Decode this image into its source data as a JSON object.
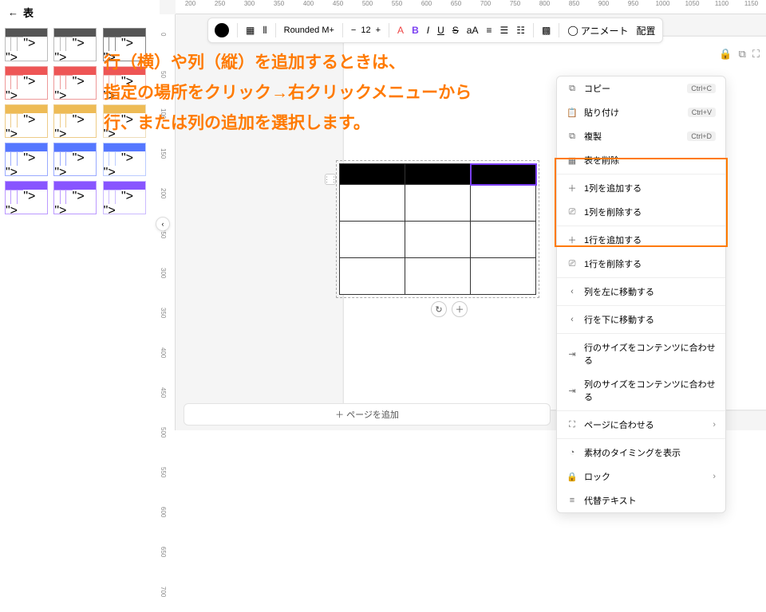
{
  "sidebar": {
    "back": "←",
    "title": "表"
  },
  "ruler_h": [
    "200",
    "250",
    "300",
    "350",
    "400",
    "450",
    "500",
    "550",
    "600",
    "650",
    "700",
    "750",
    "800",
    "850",
    "900",
    "950",
    "1000",
    "1050",
    "1100",
    "1150"
  ],
  "ruler_v": [
    "0",
    "50",
    "100",
    "150",
    "200",
    "250",
    "300",
    "350",
    "400",
    "450",
    "500",
    "550",
    "600",
    "650",
    "700"
  ],
  "toolbar": {
    "font": "Rounded M+",
    "minus": "−",
    "size": "12",
    "plus": "+",
    "bold": "B",
    "italic": "I",
    "underline": "U",
    "strike": "S",
    "aa": "aA",
    "animate": "アニメート",
    "pos": "配置"
  },
  "overlay": {
    "l1": "行（横）や列（縦）を追加するときは、",
    "l2": "指定の場所をクリック→右クリックメニューから",
    "l3": "行、または列の追加を選択します。"
  },
  "menu": {
    "copy": {
      "ic": "⧉",
      "lbl": "コピー",
      "sc": "Ctrl+C"
    },
    "paste": {
      "ic": "📋",
      "lbl": "貼り付け",
      "sc": "Ctrl+V"
    },
    "dup": {
      "ic": "⧉",
      "lbl": "複製",
      "sc": "Ctrl+D"
    },
    "deltable": {
      "ic": "▦",
      "lbl": "表を削除"
    },
    "addcol": {
      "ic": "＋",
      "lbl": "1列を追加する"
    },
    "delcol": {
      "ic": "⎚",
      "lbl": "1列を削除する"
    },
    "addrow": {
      "ic": "＋",
      "lbl": "1行を追加する"
    },
    "delrow": {
      "ic": "⎚",
      "lbl": "1行を削除する"
    },
    "moveleft": {
      "ic": "‹",
      "lbl": "列を左に移動する"
    },
    "movedown": {
      "ic": "‹",
      "lbl": "行を下に移動する"
    },
    "fitrow": {
      "ic": "⇥",
      "lbl": "行のサイズをコンテンツに合わせる"
    },
    "fitcol": {
      "ic": "⇥",
      "lbl": "列のサイズをコンテンツに合わせる"
    },
    "fitpage": {
      "ic": "⛶",
      "lbl": "ページに合わせる"
    },
    "timing": {
      "ic": "◔",
      "lbl": "素材のタイミングを表示"
    },
    "lock": {
      "ic": "🔒",
      "lbl": "ロック"
    },
    "alt": {
      "ic": "≡",
      "lbl": "代替テキスト"
    }
  },
  "addpage": "＋ ページを追加",
  "collapse": "‹",
  "drag": "⋮⋮",
  "rot": "↻",
  "add": "＋",
  "styles": [
    {
      "hd": "#555",
      "bd": "#bbb"
    },
    {
      "hd": "#555",
      "bd": "#bbb"
    },
    {
      "hd": "#555",
      "bd": "#888"
    },
    {
      "hd": "#e55",
      "bd": "#e99"
    },
    {
      "hd": "#e55",
      "bd": "#e99"
    },
    {
      "hd": "#e55",
      "bd": "#ebb"
    },
    {
      "hd": "#eb5",
      "bd": "#ec8"
    },
    {
      "hd": "#eb5",
      "bd": "#ec8"
    },
    {
      "hd": "#eb5",
      "bd": "#edb"
    },
    {
      "hd": "#57f",
      "bd": "#9af"
    },
    {
      "hd": "#57f",
      "bd": "#9af"
    },
    {
      "hd": "#57f",
      "bd": "#bcf"
    },
    {
      "hd": "#85f",
      "bd": "#b9f"
    },
    {
      "hd": "#85f",
      "bd": "#b9f"
    },
    {
      "hd": "#85f",
      "bd": "#cbf"
    }
  ]
}
